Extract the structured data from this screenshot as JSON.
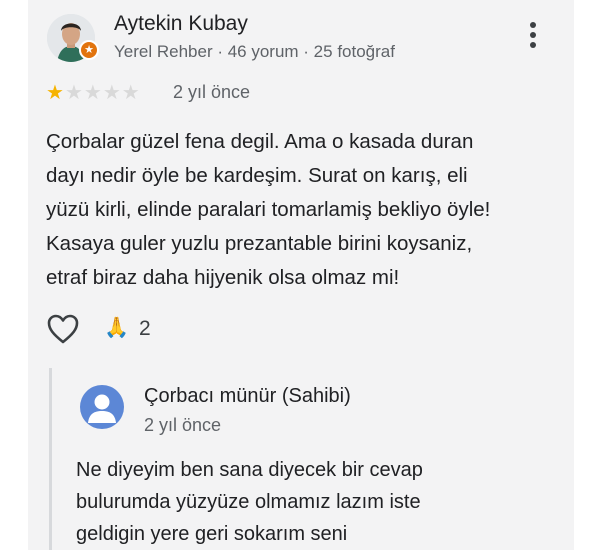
{
  "review": {
    "author": "Aytekin Kubay",
    "author_meta": "Yerel Rehber · 46 yorum · 25 fotoğraf",
    "rating": 1,
    "rating_max": 5,
    "date": "2 yıl önce",
    "text": "Çorbalar güzel fena degil. Ama o kasada duran\ndayı nedir öyle be kardeşim. Surat on karış, eli\nyüzü kirli, elinde paralari tomarlamiş bekliyo öyle!\nKasaya guler yuzlu prezantable birini koysaniz,\netraf biraz daha hijyenik olsa olmaz mi!",
    "reaction_emoji": "🙏",
    "reaction_count": "2",
    "icons": {
      "menu": "more-vert-icon",
      "like": "heart-icon",
      "badge": "local-guide-star-icon"
    }
  },
  "reply": {
    "author": "Çorbacı münür (Sahibi)",
    "date": "2 yıl önce",
    "text": "Ne diyeyim ben sana diyecek bir cevap\nbulurumda yüzyüze olmamız lazım iste\ngeldigin yere geri sokarım seni",
    "icons": {
      "avatar": "person-avatar-icon"
    }
  },
  "colors": {
    "star": "#f6b300",
    "badge": "#e2740e",
    "reply_avatar": "#5c87d6"
  }
}
